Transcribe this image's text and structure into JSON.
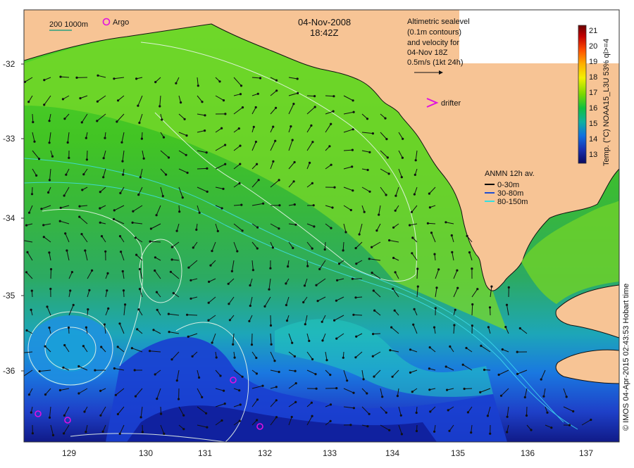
{
  "header": {
    "date": "04-Nov-2008",
    "time": "18:42Z"
  },
  "scale_bar": {
    "label": "200  1000m"
  },
  "argo_label": "Argo",
  "altimetry_note": {
    "lines": [
      "Altimetric sealevel",
      "(0.1m contours)",
      "and velocity for",
      "04-Nov 18Z",
      "0.5m/s (1kt 24h)"
    ]
  },
  "drifter_label": "drifter",
  "anmn": {
    "title": "ANMN 12h av.",
    "items": [
      {
        "label": "0-30m",
        "color": "#000000"
      },
      {
        "label": "30-80m",
        "color": "#1f4fd0"
      },
      {
        "label": "80-150m",
        "color": "#33e0e0"
      }
    ]
  },
  "colorbar": {
    "label": "Temp. (°C) NOAA15_L3U 53% ql>=4",
    "ticks": [
      "21",
      "20",
      "19",
      "18",
      "17",
      "16",
      "15",
      "14",
      "13"
    ],
    "min": 12.5,
    "max": 21.5
  },
  "credit": "© IMOS 04-Apr-2015 02:43:53 Hobart time",
  "map": {
    "lon_ticks": [
      "129",
      "130",
      "131",
      "132",
      "133",
      "134",
      "135",
      "136",
      "137"
    ],
    "lat_ticks": [
      "-32",
      "-33",
      "-34",
      "-35",
      "-36"
    ],
    "land_color": "#f7c495",
    "argo_color": "#e010e0"
  }
}
